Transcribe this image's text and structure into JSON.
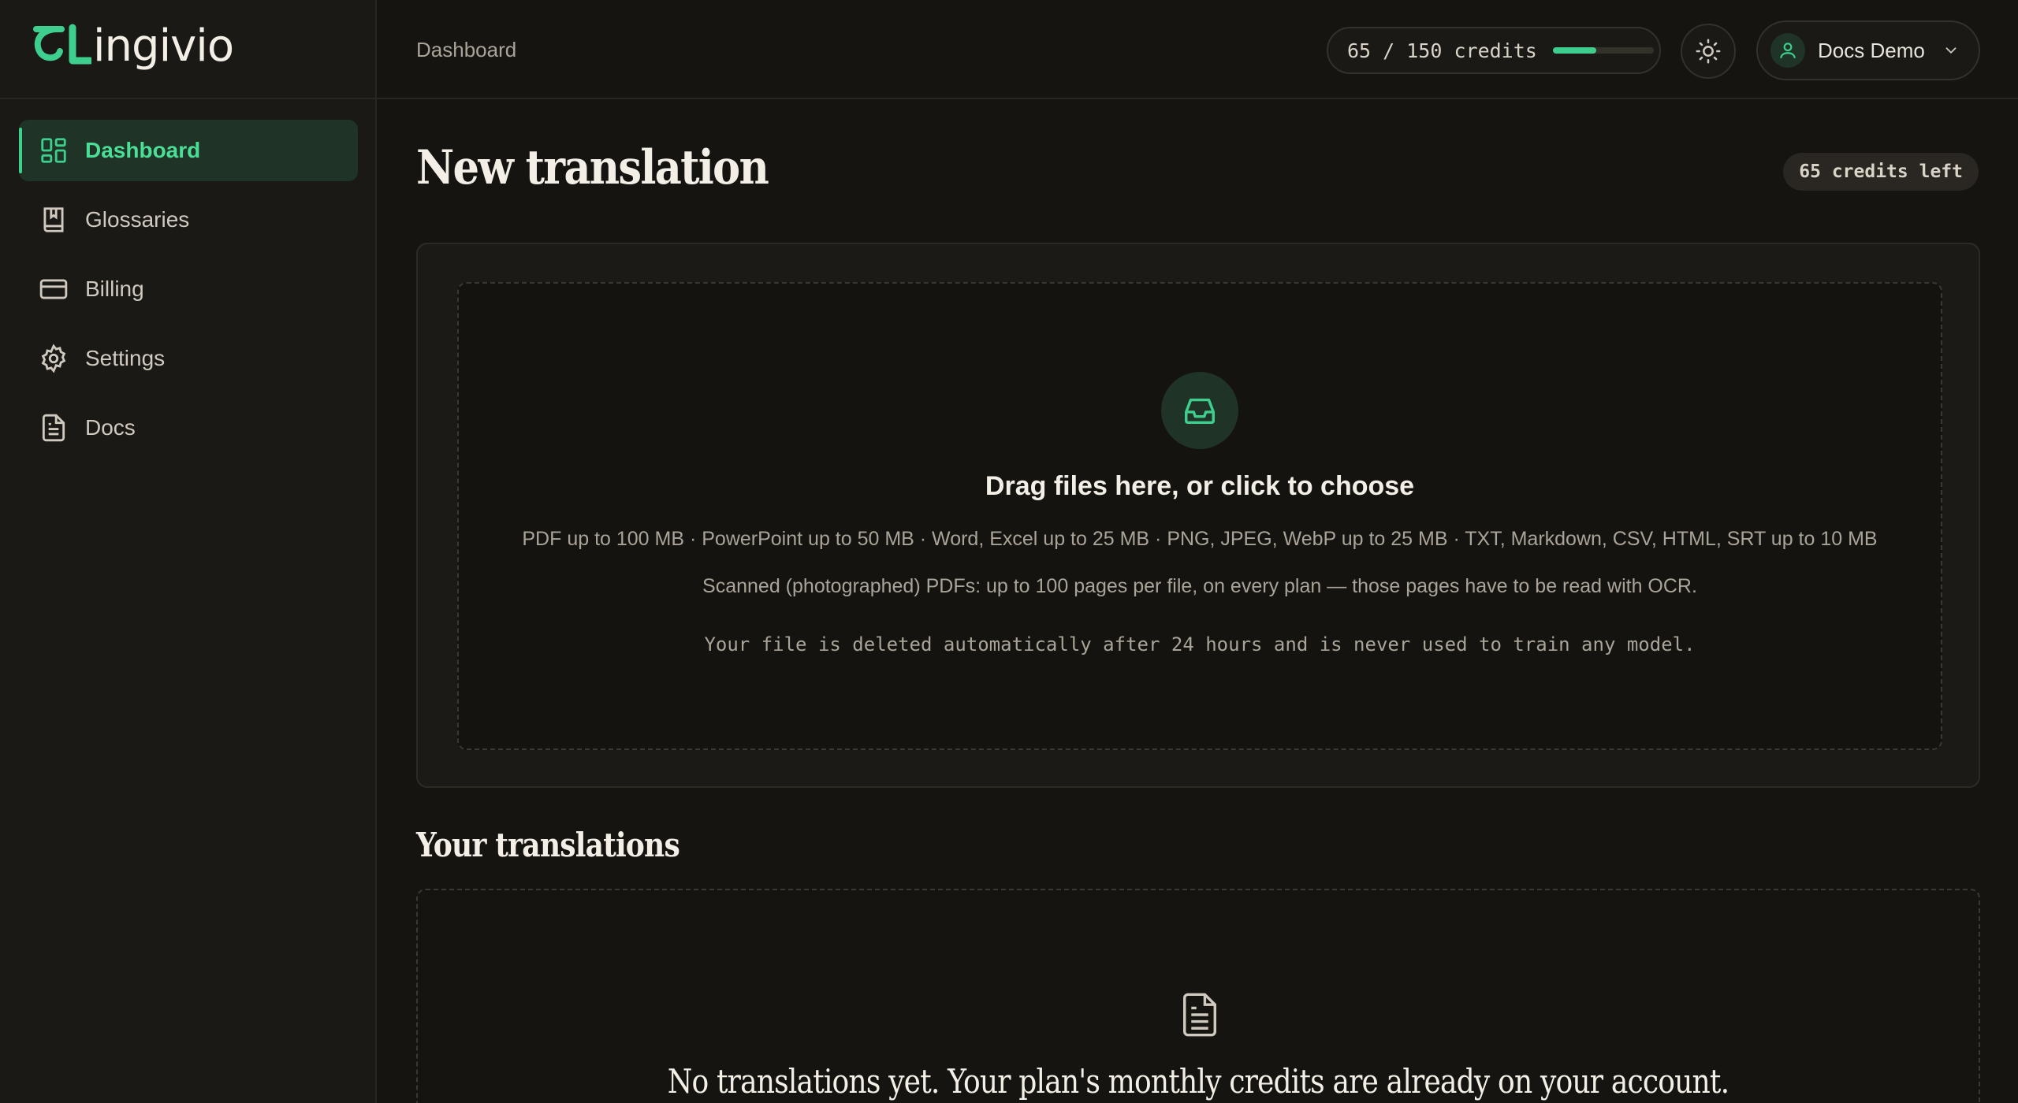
{
  "app": {
    "logo_text": "ingivio"
  },
  "sidebar": {
    "items": [
      {
        "label": "Dashboard",
        "icon": "dashboard-grid-icon",
        "active": true
      },
      {
        "label": "Glossaries",
        "icon": "book-bookmark-icon",
        "active": false
      },
      {
        "label": "Billing",
        "icon": "credit-card-icon",
        "active": false
      },
      {
        "label": "Settings",
        "icon": "gear-icon",
        "active": false
      },
      {
        "label": "Docs",
        "icon": "document-icon",
        "active": false
      }
    ]
  },
  "header": {
    "breadcrumb": "Dashboard",
    "credits_text": "65 / 150 credits",
    "credits_used": 65,
    "credits_total": 150,
    "theme_icon": "sun-icon",
    "user_name": "Docs Demo"
  },
  "main": {
    "title": "New translation",
    "credits_left_badge": "65 credits left",
    "upload": {
      "icon": "inbox-icon",
      "title": "Drag files here, or click to choose",
      "limits": "PDF up to 100 MB · PowerPoint up to 50 MB · Word, Excel up to 25 MB · PNG, JPEG, WebP up to 25 MB · TXT, Markdown, CSV, HTML, SRT up to 10 MB",
      "scanned": "Scanned (photographed) PDFs: up to 100 pages per file, on every plan — those pages have to be read with OCR.",
      "privacy": "Your file is deleted automatically after 24 hours and is never used to train any model."
    },
    "translations": {
      "title": "Your translations",
      "empty_icon": "document-icon",
      "empty_text": "No translations yet. Your plan's monthly credits are already on your account."
    }
  },
  "colors": {
    "accent": "#3ecf8e",
    "background": "#161411",
    "sidebar": "#1b1915"
  }
}
